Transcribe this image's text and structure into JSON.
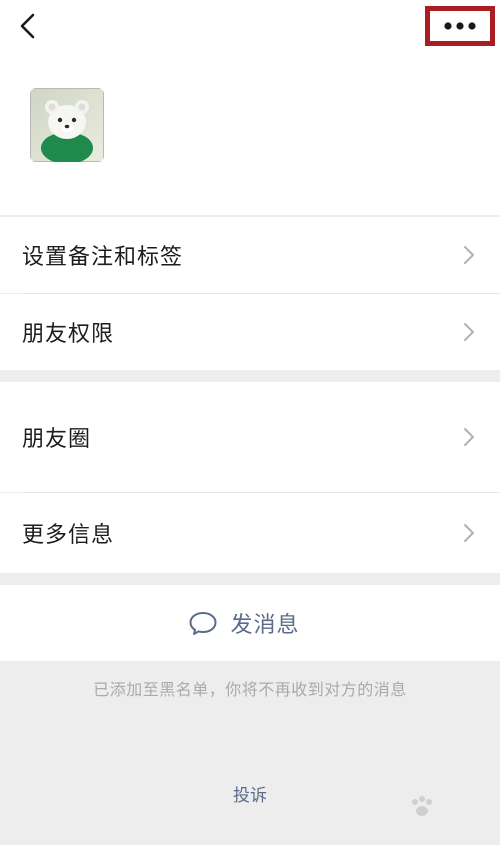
{
  "header": {
    "back_icon": "chevron-left-icon",
    "more_icon": "ellipsis-icon"
  },
  "profile": {
    "avatar_icon": "avatar-bear-image"
  },
  "menu": {
    "remark_label": "设置备注和标签",
    "permissions_label": "朋友权限",
    "moments_label": "朋友圈",
    "more_info_label": "更多信息"
  },
  "actions": {
    "send_message_label": "发消息",
    "send_message_icon": "chat-bubble-icon"
  },
  "notice": {
    "blacklist_text": "已添加至黑名单，你将不再收到对方的消息"
  },
  "footer": {
    "report_label": "投诉"
  },
  "colors": {
    "highlight_border": "#a81e22",
    "link_text": "#5b6b8a",
    "background": "#ededed"
  }
}
